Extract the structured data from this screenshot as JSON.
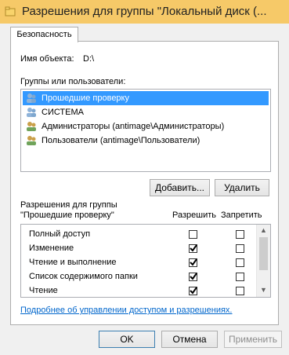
{
  "window": {
    "title": "Разрешения для группы \"Локальный диск (..."
  },
  "tabs": [
    {
      "label": "Безопасность"
    }
  ],
  "object": {
    "label": "Имя объекта:",
    "value": "D:\\"
  },
  "groups": {
    "label": "Группы или пользователи:",
    "items": [
      {
        "label": "Прошедшие проверку",
        "selected": true
      },
      {
        "label": "СИСТЕМА"
      },
      {
        "label": "Администраторы (antimage\\Администраторы)"
      },
      {
        "label": "Пользователи (antimage\\Пользователи)"
      }
    ],
    "add_label": "Добавить...",
    "remove_label": "Удалить"
  },
  "permissions": {
    "heading_line1": "Разрешения для группы",
    "heading_line2": "\"Прошедшие проверку\"",
    "allow_header": "Разрешить",
    "deny_header": "Запретить",
    "rows": [
      {
        "name": "Полный доступ",
        "allow": false,
        "deny": false
      },
      {
        "name": "Изменение",
        "allow": true,
        "deny": false
      },
      {
        "name": "Чтение и выполнение",
        "allow": true,
        "deny": false
      },
      {
        "name": "Список содержимого папки",
        "allow": true,
        "deny": false
      },
      {
        "name": "Чтение",
        "allow": true,
        "deny": false
      },
      {
        "name": "",
        "allow": false,
        "deny": false
      }
    ]
  },
  "link": "Подробнее об управлении доступом и разрешениях.",
  "buttons": {
    "ok": "OK",
    "cancel": "Отмена",
    "apply": "Применить"
  },
  "colors": {
    "titlebar": "#f6c968",
    "selection": "#3399ff",
    "link": "#0066cc"
  }
}
